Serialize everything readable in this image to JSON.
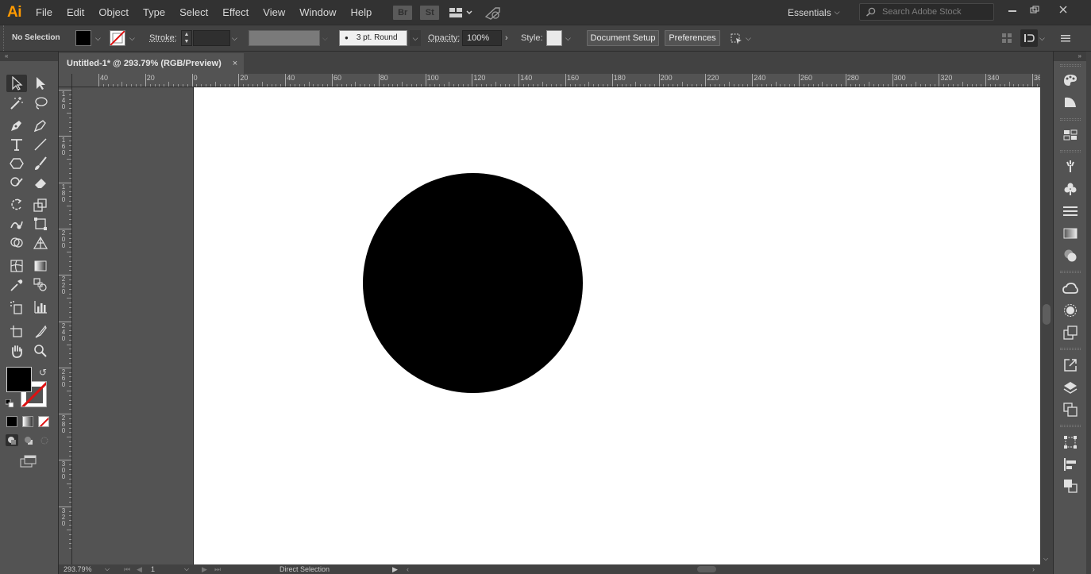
{
  "app": {
    "logo": "Ai"
  },
  "menubar": {
    "items": [
      "File",
      "Edit",
      "Object",
      "Type",
      "Select",
      "Effect",
      "View",
      "Window",
      "Help"
    ],
    "bridge_label": "Br",
    "stock_label": "St",
    "workspace": "Essentials",
    "search_placeholder": "Search Adobe Stock"
  },
  "controlbar": {
    "selection_status": "No Selection",
    "fill_color": "#000000",
    "stroke_label": "Stroke:",
    "stroke_weight": "",
    "brush_profile": "3 pt. Round",
    "opacity_label": "Opacity:",
    "opacity_value": "100%",
    "style_label": "Style:",
    "document_setup": "Document Setup",
    "preferences": "Preferences"
  },
  "document": {
    "tab_title": "Untitled-1* @ 293.79% (RGB/Preview)",
    "close": "×"
  },
  "rulers": {
    "horizontal": [
      "40",
      "20",
      "0",
      "20",
      "40",
      "60",
      "80",
      "100",
      "120",
      "140",
      "160",
      "180",
      "200",
      "220",
      "240",
      "260",
      "280",
      "300",
      "320",
      "340",
      "36"
    ],
    "vertical": [
      "140",
      "160",
      "180",
      "200",
      "220",
      "240",
      "260",
      "280",
      "300",
      "320"
    ]
  },
  "artwork": {
    "shape": "circle",
    "fill": "#000000"
  },
  "statusbar": {
    "zoom": "293.79%",
    "artboard_number": "1",
    "current_tool": "Direct Selection"
  },
  "colors": {
    "accent_logo": "#ff9a00",
    "chrome_dark": "#323232",
    "chrome_mid": "#424242",
    "chrome_panel": "#535353",
    "artboard": "#ffffff"
  }
}
